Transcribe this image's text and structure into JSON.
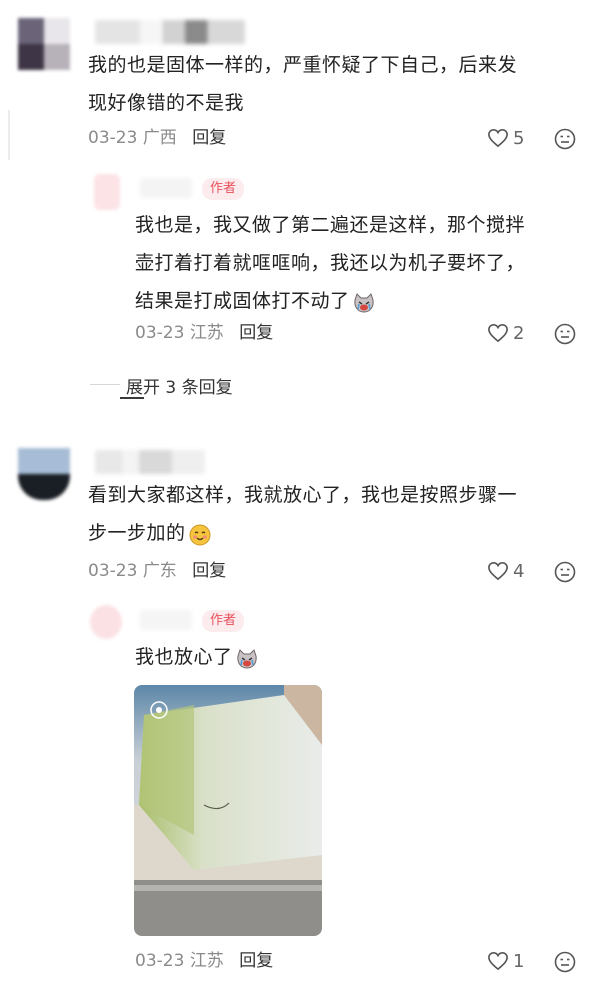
{
  "comments": [
    {
      "text_lines": [
        "我的也是固体一样的，严重怀疑了下自己，后来发",
        "现好像错的不是我"
      ],
      "date": "03-23",
      "location": "广西",
      "reply_label": "回复",
      "likes": "5",
      "icons": {
        "like": "heart-outline-icon",
        "dislike": "meh-face-icon"
      }
    },
    {
      "author_tag": "作者",
      "text_lines": [
        "我也是，我又做了第二遍还是这样，那个搅拌",
        "壶打着打着就哐哐响，我还以为机子要坏了，",
        "结果是打成固体打不动了"
      ],
      "emoji": "crying-cat-emoji",
      "date": "03-23",
      "location": "江苏",
      "reply_label": "回复",
      "likes": "2"
    },
    {
      "text_lines": [
        "看到大家都这样，我就放心了，我也是按照步骤一",
        "步一步加的"
      ],
      "emoji": "smiling-face-emoji",
      "date": "03-23",
      "location": "广东",
      "reply_label": "回复",
      "likes": "4"
    },
    {
      "author_tag": "作者",
      "text_lines": [
        "我也放心了"
      ],
      "emoji": "crying-cat-emoji",
      "date": "03-23",
      "location": "江苏",
      "reply_label": "回复",
      "likes": "1"
    }
  ],
  "expand_replies_label": "展开 3 条回复",
  "colors": {
    "author_tag_text": "#e8515c",
    "author_tag_bg": "#fdecee",
    "meta_text": "#8a8a8a"
  }
}
